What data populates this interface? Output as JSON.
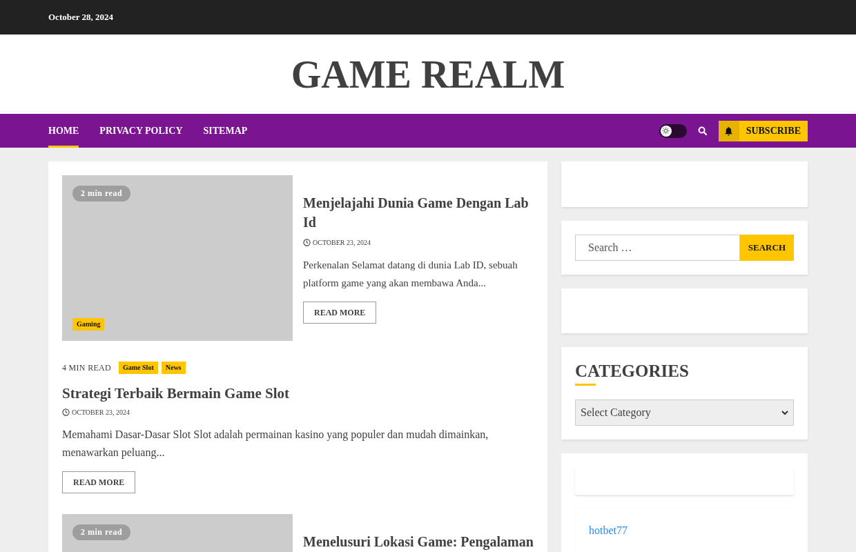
{
  "top_bar": {
    "date": "October 28, 2024"
  },
  "site_title": "GAME REALM",
  "nav": {
    "items": [
      {
        "label": "HOME",
        "selected": true
      },
      {
        "label": "PRIVACY POLICY",
        "selected": false
      },
      {
        "label": "SITEMAP",
        "selected": false
      }
    ],
    "theme_toggle": {
      "on": false
    },
    "subscribe": "SUBSCRIBE"
  },
  "posts": [
    {
      "kind": "image_left",
      "read_time": "2 min read",
      "categories": [
        "Gaming"
      ],
      "title": "Menjelajahi Dunia Game Dengan Lab Id",
      "date": "OCTOBER 23, 2024",
      "excerpt": "Perkenalan Selamat datang di dunia Lab ID, sebuah platform game yang akan membawa Anda...",
      "button": "READ MORE"
    },
    {
      "kind": "text_only",
      "read_time": "4 MIN READ",
      "categories": [
        "Game Slot",
        "News"
      ],
      "title": "Strategi Terbaik Bermain Game Slot",
      "date": "OCTOBER 23, 2024",
      "excerpt": "Memahami Dasar-Dasar Slot Slot adalah permainan kasino yang populer dan mudah dimainkan, menawarkan peluang...",
      "button": "READ MORE"
    },
    {
      "kind": "image_left",
      "read_time": "2 min read",
      "title": "Menelusuri Lokasi Game: Pengalaman"
    }
  ],
  "sidebar": {
    "search": {
      "placeholder": "Search …",
      "button": "SEARCH"
    },
    "categories": {
      "heading": "CATEGORIES",
      "select": "Select Category"
    },
    "links": [
      "hotbet77"
    ]
  }
}
